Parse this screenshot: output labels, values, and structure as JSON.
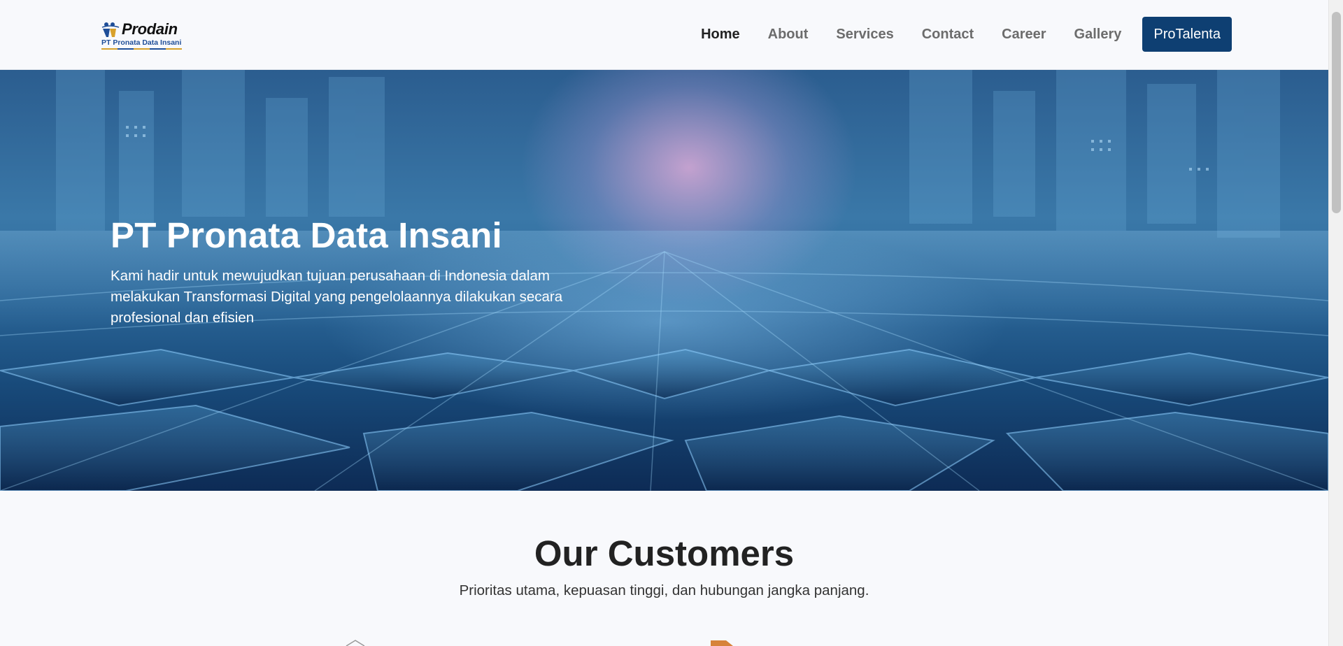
{
  "logo": {
    "name": "Prodain",
    "subtitle": "PT Pronata Data Insani"
  },
  "nav": {
    "items": [
      {
        "label": "Home",
        "active": true
      },
      {
        "label": "About",
        "active": false
      },
      {
        "label": "Services",
        "active": false
      },
      {
        "label": "Contact",
        "active": false
      },
      {
        "label": "Career",
        "active": false
      },
      {
        "label": "Gallery",
        "active": false
      }
    ],
    "cta_label": "ProTalenta"
  },
  "hero": {
    "title": "PT Pronata Data Insani",
    "description": "Kami hadir untuk mewujudkan tujuan perusahaan di Indonesia dalam melakukan Transformasi Digital yang pengelolaannya dilakukan secara profesional dan efisien"
  },
  "customers": {
    "title": "Our Customers",
    "subtitle": "Prioritas utama, kepuasan tinggi, dan hubungan jangka panjang."
  },
  "colors": {
    "brand": "#0e3f72",
    "page_background": "#f8f9fc"
  }
}
